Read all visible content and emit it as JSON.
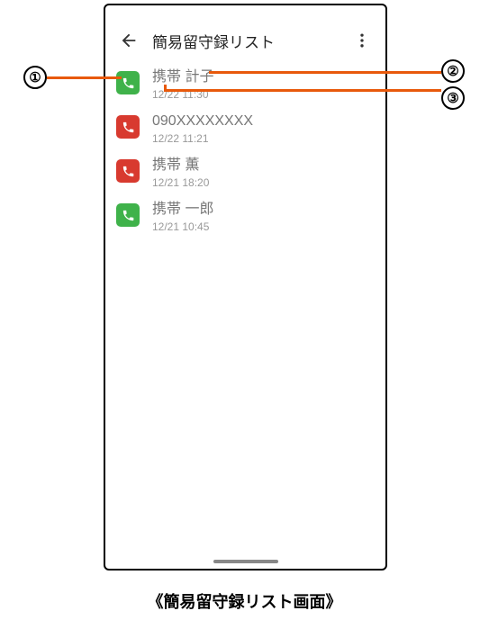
{
  "app_bar": {
    "title": "簡易留守録リスト"
  },
  "list": {
    "items": [
      {
        "name": "携帯 計子",
        "time": "12/22 11:30",
        "icon_color": "green"
      },
      {
        "name": "090XXXXXXXX",
        "time": "12/22 11:21",
        "icon_color": "red"
      },
      {
        "name": "携帯 薫",
        "time": "12/21 18:20",
        "icon_color": "red"
      },
      {
        "name": "携帯 一郎",
        "time": "12/21 10:45",
        "icon_color": "green"
      }
    ]
  },
  "callouts": {
    "1": "①",
    "2": "②",
    "3": "③"
  },
  "caption": "《簡易留守録リスト画面》"
}
